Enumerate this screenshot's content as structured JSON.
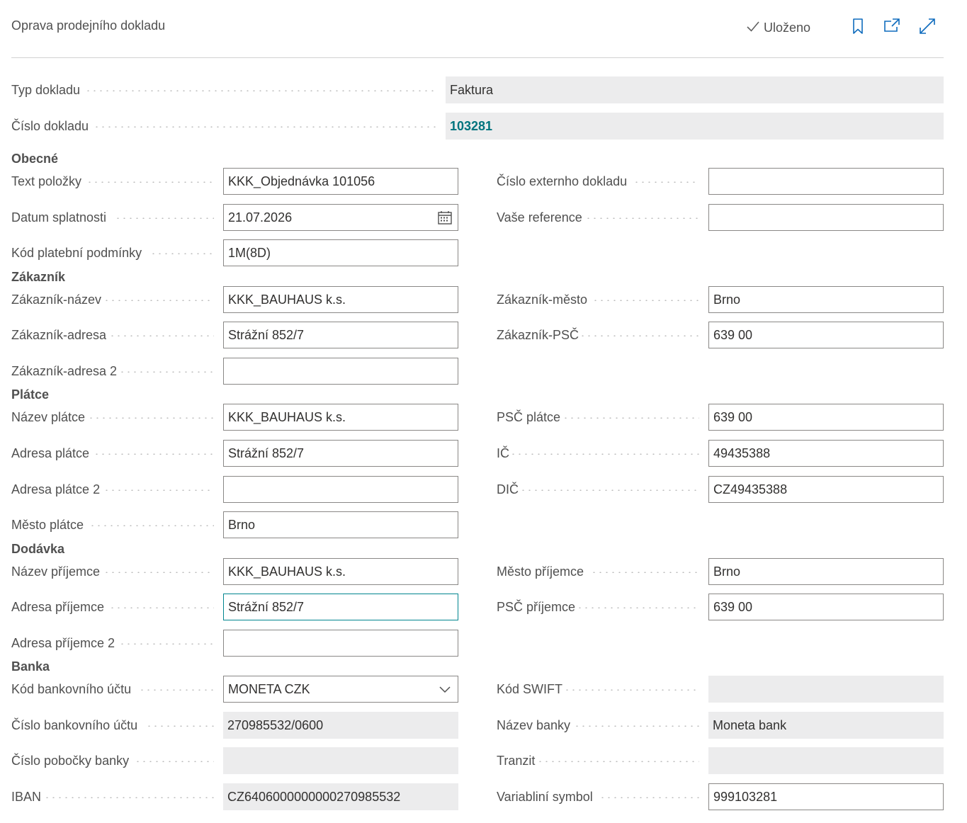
{
  "header": {
    "title": "Oprava prodejního dokladu",
    "saved_label": "Uloženo",
    "icons": [
      "checkmark-icon",
      "bookmark-icon",
      "open-in-new-window-icon",
      "expand-icon"
    ]
  },
  "document": {
    "type_label": "Typ dokladu",
    "type_value": "Faktura",
    "number_label": "Číslo dokladu",
    "number_value": "103281"
  },
  "sections": {
    "general": "Obecné",
    "customer": "Zákazník",
    "payer": "Plátce",
    "delivery": "Dodávka",
    "bank": "Banka"
  },
  "general": {
    "item_text_label": "Text položky",
    "item_text_value": "KKK_Objednávka 101056",
    "due_date_label": "Datum splatnosti",
    "due_date_value": "21.07.2026",
    "payment_terms_label": "Kód platební podmínky",
    "payment_terms_value": "1M(8D)",
    "external_doc_label": "Číslo externho dokladu",
    "external_doc_value": "",
    "your_ref_label": "Vaše reference",
    "your_ref_value": ""
  },
  "customer": {
    "name_label": "Zákazník-název",
    "name_value": "KKK_BAUHAUS  k.s.",
    "address_label": "Zákazník-adresa",
    "address_value": "Strážní 852/7",
    "address2_label": "Zákazník-adresa 2",
    "address2_value": "",
    "city_label": "Zákazník-město",
    "city_value": "Brno",
    "zip_label": "Zákazník-PSČ",
    "zip_value": "639 00"
  },
  "payer": {
    "name_label": "Název plátce",
    "name_value": "KKK_BAUHAUS  k.s.",
    "address_label": "Adresa plátce",
    "address_value": "Strážní 852/7",
    "address2_label": "Adresa plátce 2",
    "address2_value": "",
    "city_label": "Město plátce",
    "city_value": "Brno",
    "zip_label": "PSČ plátce",
    "zip_value": "639 00",
    "ic_label": "IČ",
    "ic_value": "49435388",
    "dic_label": "DIČ",
    "dic_value": "CZ49435388"
  },
  "delivery": {
    "name_label": "Název příjemce",
    "name_value": "KKK_BAUHAUS  k.s.",
    "address_label": "Adresa příjemce",
    "address_value": "Strážní 852/7",
    "address2_label": "Adresa příjemce 2",
    "address2_value": "",
    "city_label": "Město příjemce",
    "city_value": "Brno",
    "zip_label": "PSČ příjemce",
    "zip_value": "639 00"
  },
  "bank": {
    "account_code_label": "Kód bankovního účtu",
    "account_code_value": "MONETA CZK",
    "account_number_label": "Číslo bankovního účtu",
    "account_number_value": "270985532/0600",
    "branch_label": "Číslo pobočky banky",
    "branch_value": "",
    "iban_label": "IBAN",
    "iban_value": "CZ6406000000000270985532",
    "swift_label": "Kód SWIFT",
    "swift_value": "",
    "bank_name_label": "Název banky",
    "bank_name_value": "Moneta bank",
    "transit_label": "Tranzit",
    "transit_value": "",
    "var_symbol_label": "Variabliní symbol",
    "var_symbol_value": "999103281"
  },
  "colors": {
    "accent_teal": "#00747e",
    "focus_border": "#00858f",
    "readonly_bg": "#ececed",
    "icon_blue": "#0f6cbd"
  }
}
